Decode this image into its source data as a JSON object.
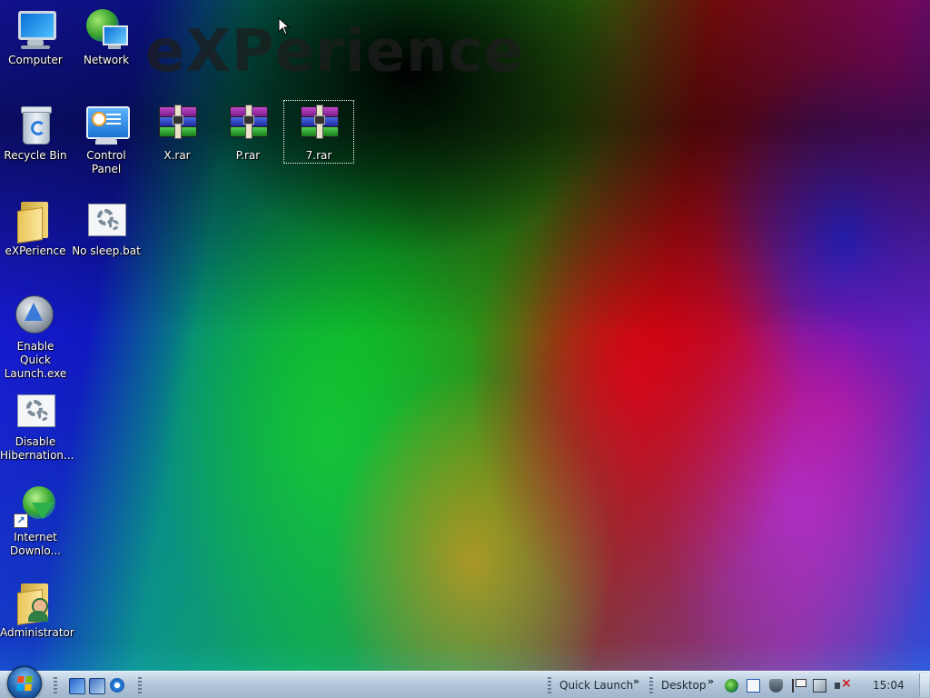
{
  "wallpaper": {
    "title": "eXPerience"
  },
  "desktop_icons": [
    {
      "label": "Computer",
      "icon": "computer-icon"
    },
    {
      "label": "Network",
      "icon": "network-icon"
    },
    {
      "label": "Recycle Bin",
      "icon": "recycle-bin-icon"
    },
    {
      "label": "Control Panel",
      "icon": "control-panel-icon"
    },
    {
      "label": "X.rar",
      "icon": "rar-archive-icon"
    },
    {
      "label": "P.rar",
      "icon": "rar-archive-icon"
    },
    {
      "label": "7.rar",
      "icon": "rar-archive-icon",
      "selected": true
    },
    {
      "label": "eXPerience",
      "icon": "folder-icon"
    },
    {
      "label": "No sleep.bat",
      "icon": "batch-file-icon"
    },
    {
      "label": "Enable Quick Launch.exe",
      "icon": "application-icon"
    },
    {
      "label": "Disable Hibernation...",
      "icon": "batch-file-icon"
    },
    {
      "label": "Internet Downlo...",
      "icon": "download-manager-shortcut-icon"
    },
    {
      "label": "Administrator",
      "icon": "user-folder-icon"
    }
  ],
  "taskbar": {
    "start_icon": "windows-start-orb-icon",
    "quick_launch_icons": [
      "show-desktop-icon",
      "switch-windows-icon",
      "internet-explorer-icon"
    ],
    "toolbars": [
      {
        "label": "Quick Launch"
      },
      {
        "label": "Desktop"
      }
    ],
    "tray_icons": [
      "globe-icon",
      "document-icon",
      "security-shield-icon",
      "action-center-flag-icon",
      "network-icon",
      "volume-muted-icon"
    ],
    "clock": "15:04"
  },
  "colors": {
    "taskbar": "#b4c7da",
    "icon_label_text": "#ffffff",
    "wallpaper_red": "#dc0014",
    "wallpaper_green": "#14c828",
    "wallpaper_blue": "#2828e6"
  }
}
